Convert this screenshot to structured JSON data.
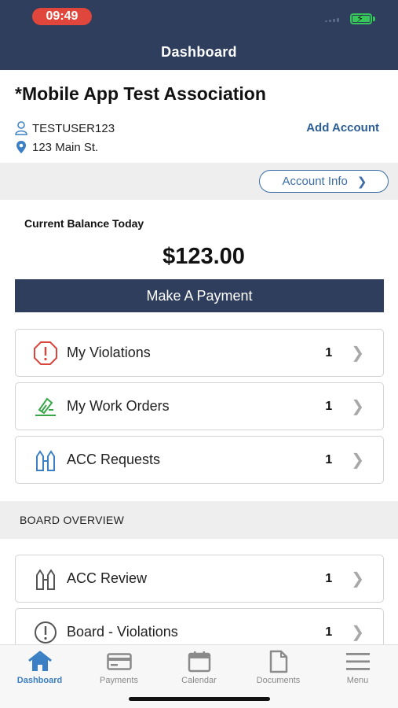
{
  "status": {
    "time": "09:49"
  },
  "header": {
    "title": "Dashboard"
  },
  "account": {
    "association_name": "*Mobile App Test Association",
    "username": "TESTUSER123",
    "address": "123 Main St.",
    "add_account_label": "Add Account",
    "account_info_label": "Account Info"
  },
  "balance": {
    "label": "Current Balance Today",
    "amount": "$123.00",
    "pay_label": "Make A Payment"
  },
  "items": [
    {
      "label": "My Violations",
      "count": "1",
      "icon": "alert-octagon-icon"
    },
    {
      "label": "My Work Orders",
      "count": "1",
      "icon": "work-order-icon"
    },
    {
      "label": "ACC Requests",
      "count": "1",
      "icon": "acc-request-icon"
    }
  ],
  "board": {
    "title": "BOARD OVERVIEW",
    "items": [
      {
        "label": "ACC Review",
        "count": "1",
        "icon": "acc-review-icon"
      },
      {
        "label": "Board - Violations",
        "count": "1",
        "icon": "alert-circle-icon"
      }
    ]
  },
  "tabs": [
    {
      "label": "Dashboard",
      "icon": "home-icon",
      "active": true
    },
    {
      "label": "Payments",
      "icon": "card-icon",
      "active": false
    },
    {
      "label": "Calendar",
      "icon": "calendar-icon",
      "active": false
    },
    {
      "label": "Documents",
      "icon": "document-icon",
      "active": false
    },
    {
      "label": "Menu",
      "icon": "menu-icon",
      "active": false
    }
  ],
  "colors": {
    "header_bg": "#2f3e5c",
    "accent_blue": "#3b7fc4",
    "violation_red": "#d9453b",
    "work_green": "#3aa64a"
  }
}
